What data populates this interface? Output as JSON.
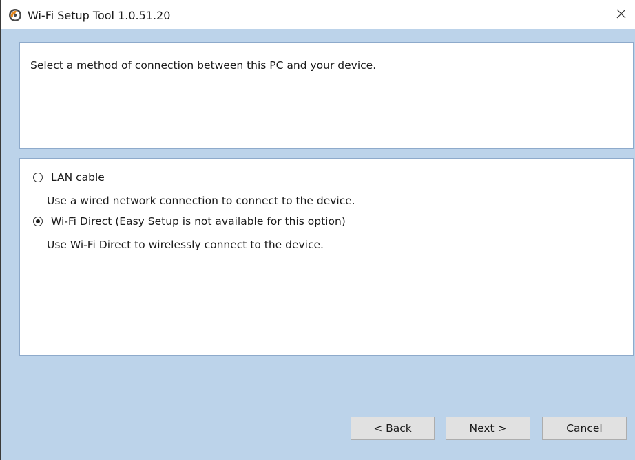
{
  "window": {
    "title": "Wi-Fi Setup Tool 1.0.51.20",
    "app_icon": "wifi-setup-app-icon",
    "close_icon": "close-icon"
  },
  "instruction": {
    "text": "Select a method of connection between this PC and your device."
  },
  "options": [
    {
      "label": "LAN cable",
      "description": "Use a wired network connection to connect to the device.",
      "selected": false
    },
    {
      "label": "Wi-Fi Direct (Easy Setup is not available for this option)",
      "description": "Use Wi-Fi Direct to wirelessly connect to the device.",
      "selected": true
    }
  ],
  "buttons": {
    "back": "< Back",
    "next": "Next >",
    "cancel": "Cancel"
  },
  "colors": {
    "window_background": "#bcd3ea",
    "panel_background": "#ffffff",
    "panel_border": "#8eaacb",
    "button_background": "#e1e1e1"
  }
}
